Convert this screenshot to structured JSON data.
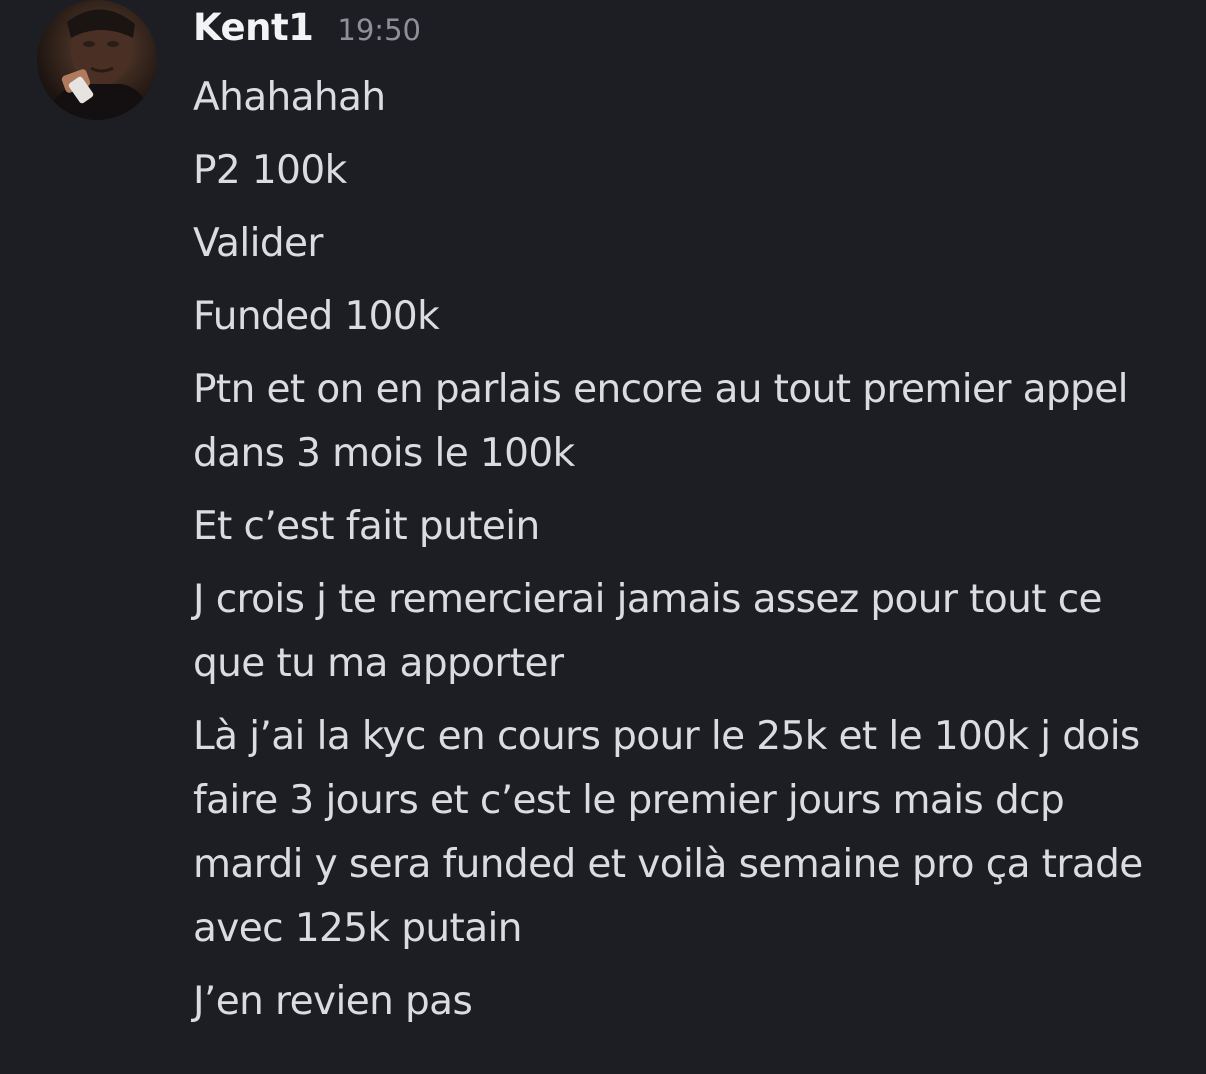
{
  "message": {
    "username": "Kent1",
    "timestamp": "19:50",
    "avatar_icon": "user-avatar-photo",
    "lines": [
      "Ahahahah",
      "P2 100k",
      "Valider",
      "Funded 100k",
      "Ptn et on en parlais encore au tout premier appel dans 3 mois le 100k",
      "Et c’est fait putein",
      "J crois j te remercierai jamais assez pour tout ce que tu ma apporter",
      "Là j’ai la kyc en cours pour le 25k et le 100k j dois faire 3 jours et c’est le premier jours mais dcp mardi y sera funded et voilà semaine pro ça trade avec 125k putain",
      "J’en revien pas"
    ]
  }
}
